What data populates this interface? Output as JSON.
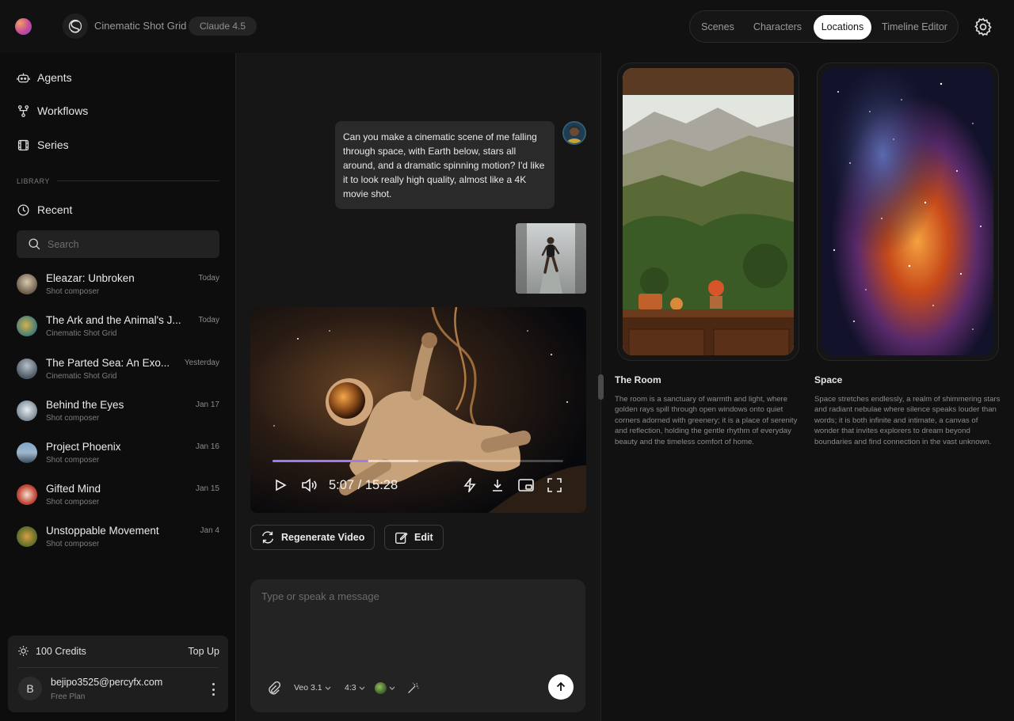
{
  "header": {
    "brand_name": "Cinematic Shot Grid",
    "model_badge": "Claude 4.5",
    "tabs": [
      {
        "label": "Scenes",
        "active": false
      },
      {
        "label": "Characters",
        "active": false
      },
      {
        "label": "Locations",
        "active": true
      },
      {
        "label": "Timeline Editor",
        "active": false
      }
    ]
  },
  "sidebar": {
    "nav": [
      {
        "label": "Agents",
        "icon": "robot-icon"
      },
      {
        "label": "Workflows",
        "icon": "workflow-icon"
      },
      {
        "label": "Series",
        "icon": "film-icon"
      }
    ],
    "library_label": "LIBRARY",
    "recent_label": "Recent",
    "search_placeholder": "Search",
    "projects": [
      {
        "title": "Eleazar: Unbroken",
        "subtitle": "Shot composer",
        "date": "Today"
      },
      {
        "title": "The Ark and the Animal's J...",
        "subtitle": "Cinematic Shot Grid",
        "date": "Today"
      },
      {
        "title": "The Parted Sea: An Exo...",
        "subtitle": "Cinematic Shot Grid",
        "date": "Yesterday"
      },
      {
        "title": "Behind the Eyes",
        "subtitle": "Shot composer",
        "date": "Jan 17"
      },
      {
        "title": "Project Phoenix",
        "subtitle": "Shot composer",
        "date": "Jan 16"
      },
      {
        "title": "Gifted Mind",
        "subtitle": "Shot composer",
        "date": "Jan 15"
      },
      {
        "title": "Unstoppable Movement",
        "subtitle": "Shot composer",
        "date": "Jan 4"
      }
    ],
    "account": {
      "credits": "100 Credits",
      "top_up": "Top Up",
      "avatar_letter": "B",
      "email": "bejipo3525@percyfx.com",
      "plan": "Free Plan"
    }
  },
  "chat": {
    "user_message": "Can you make a cinematic scene of me falling through space, with Earth below, stars all around, and a dramatic spinning motion? I'd like it to look really high quality, almost like a 4K movie shot.",
    "video": {
      "time": "5:07 / 15:28",
      "progress": 0.33,
      "buffered": 0.5
    },
    "regenerate_label": "Regenerate Video",
    "edit_label": "Edit",
    "composer": {
      "placeholder": "Type or speak a message",
      "model": "Veo 3.1",
      "aspect": "4:3"
    }
  },
  "locations": [
    {
      "title": "The Room",
      "description": "The room is a sanctuary of warmth and light, where golden rays spill through open windows onto quiet corners adorned with greenery; it is a place of serenity and reflection, holding the gentle rhythm of everyday beauty and the timeless comfort of home."
    },
    {
      "title": "Space",
      "description": "Space stretches endlessly, a realm of shimmering stars and radiant nebulae where silence speaks louder than words; it is both infinite and intimate, a canvas of wonder that invites explorers to dream beyond boundaries and find connection in the vast unknown."
    }
  ],
  "colors": {
    "accent": "#9b7cf0",
    "background": "#161616",
    "sidebar": "#0d0d0d"
  }
}
